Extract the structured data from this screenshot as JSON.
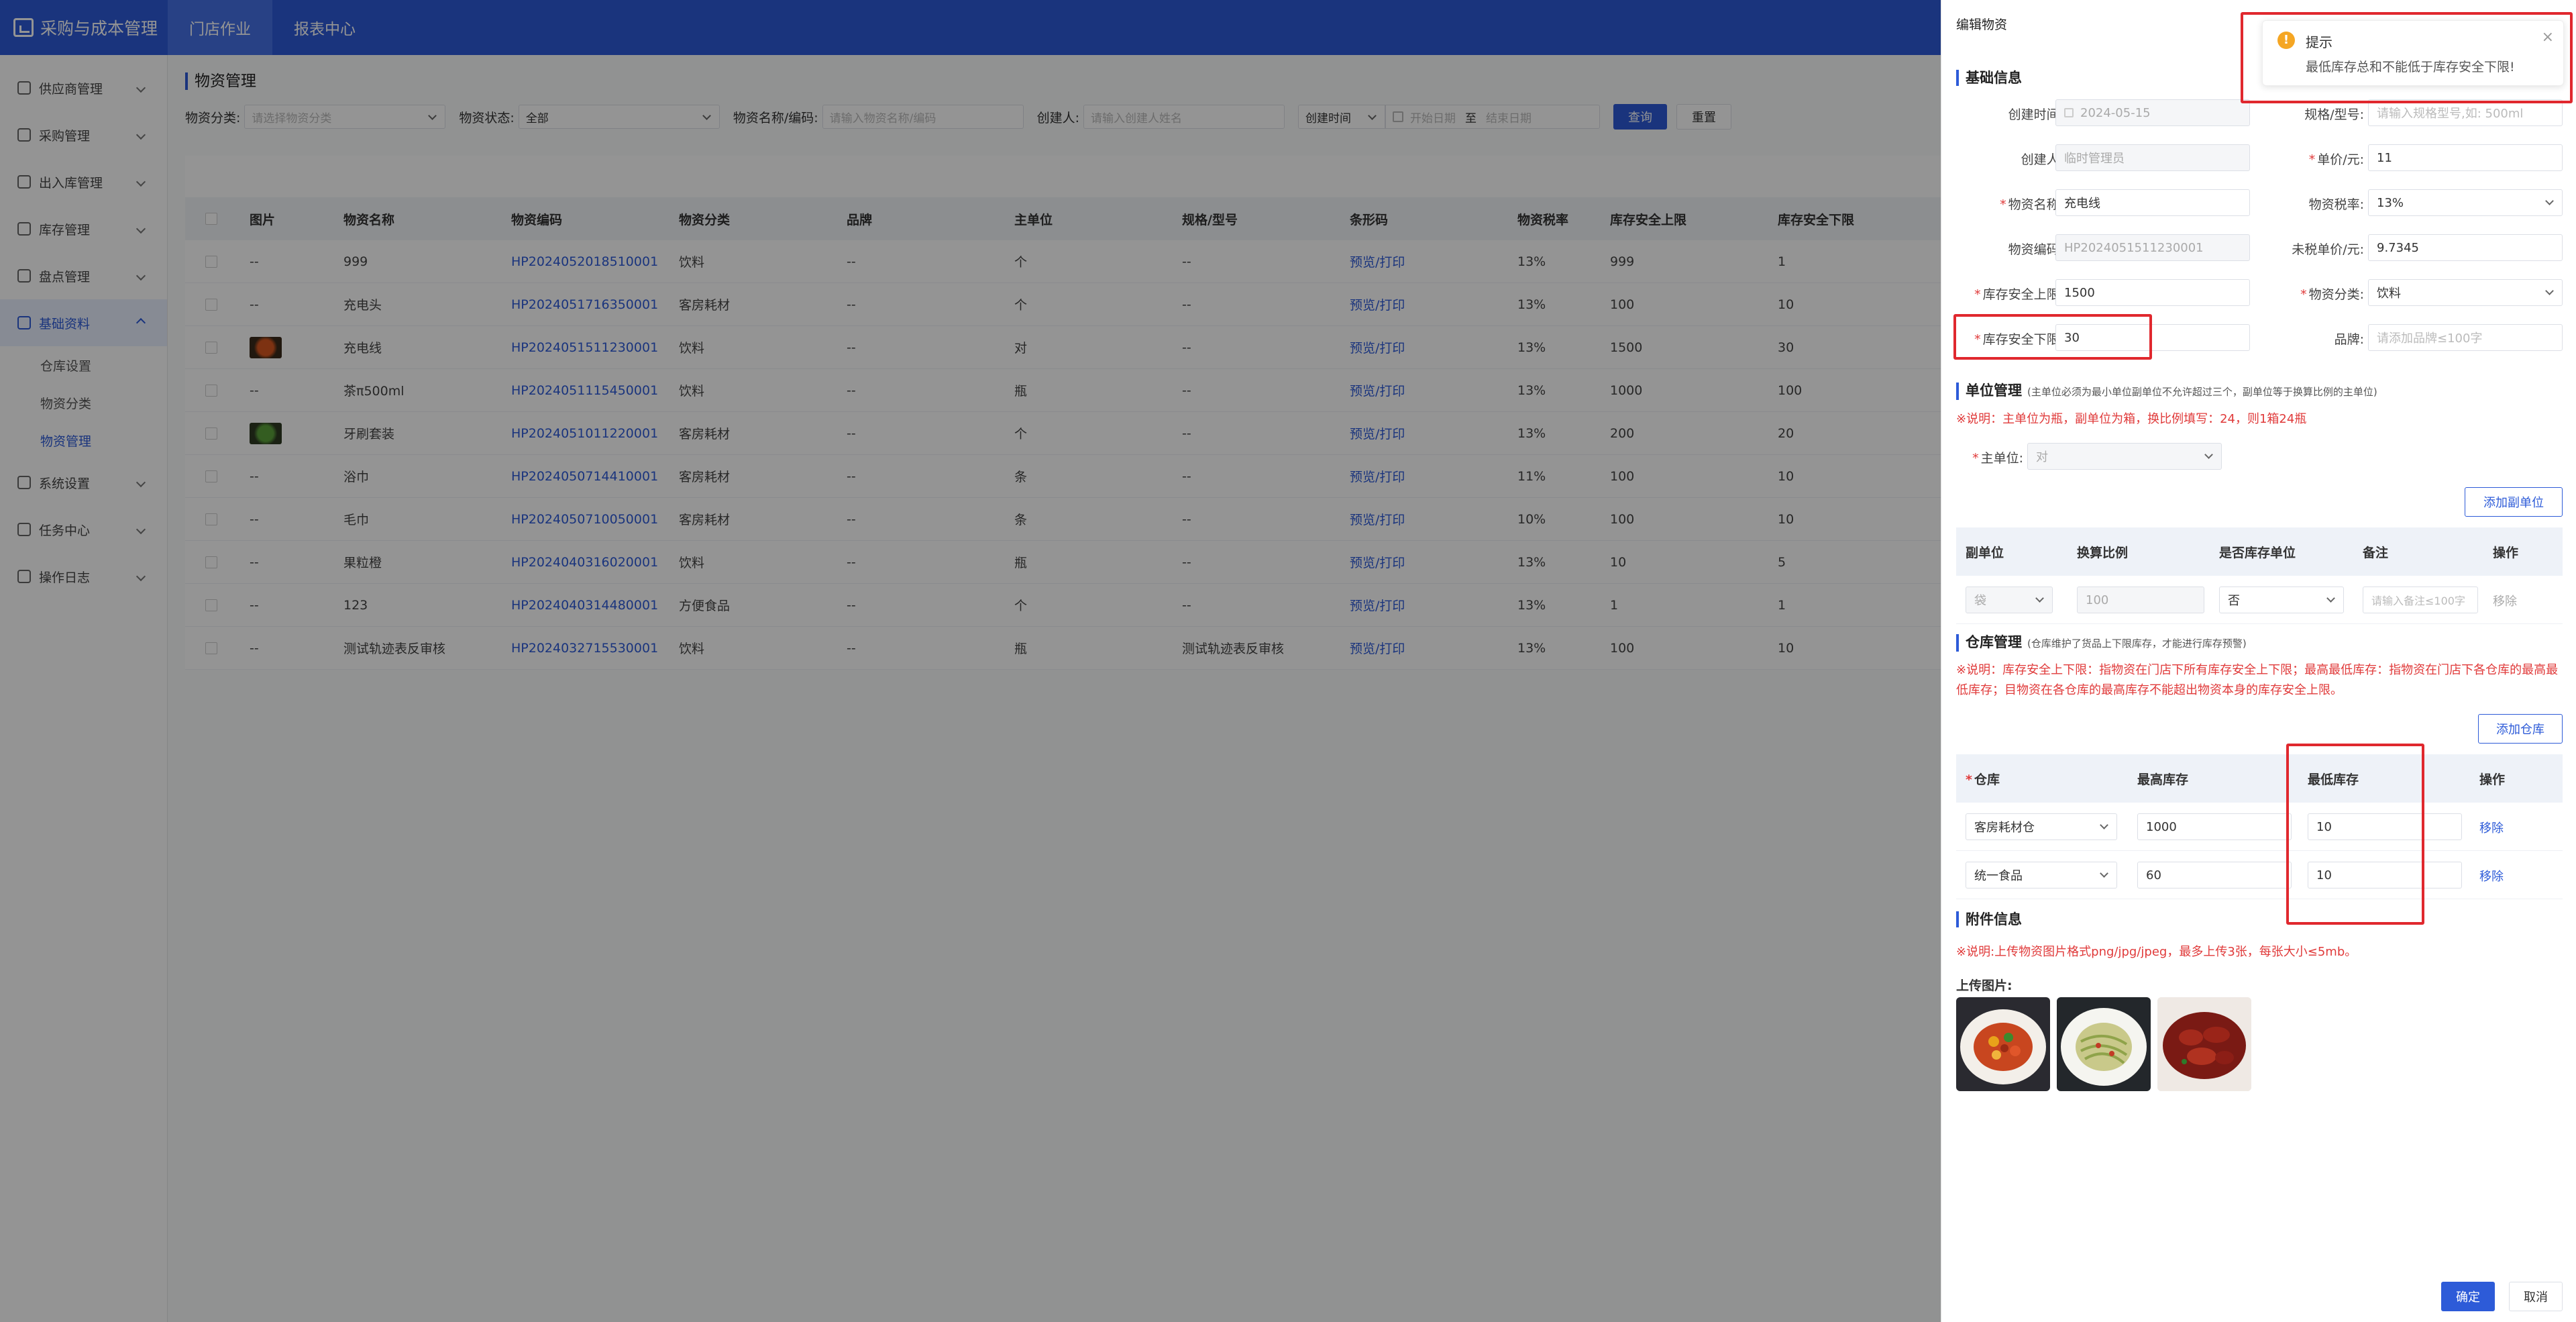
{
  "app": {
    "title": "采购与成本管理"
  },
  "topnav": [
    "门店作业",
    "报表中心"
  ],
  "sidebar": {
    "items": [
      "供应商管理",
      "采购管理",
      "出入库管理",
      "库存管理",
      "盘点管理",
      "基础资料",
      "系统设置",
      "任务中心",
      "操作日志"
    ],
    "sub_items": [
      "仓库设置",
      "物资分类",
      "物资管理"
    ]
  },
  "page": {
    "title": "物资管理"
  },
  "filters": {
    "category_label": "物资分类:",
    "category_placeholder": "请选择物资分类",
    "status_label": "物资状态:",
    "status_value": "全部",
    "name_label": "物资名称/编码:",
    "name_placeholder": "请输入物资名称/编码",
    "creator_label": "创建人:",
    "creator_placeholder": "请输入创建人姓名",
    "time_type": "创建时间",
    "start_placeholder": "开始日期",
    "range_sep": "至",
    "end_placeholder": "结束日期",
    "query_btn": "查询",
    "reset_btn": "重置"
  },
  "table": {
    "columns": [
      "图片",
      "物资名称",
      "物资编码",
      "物资分类",
      "品牌",
      "主单位",
      "规格/型号",
      "条形码",
      "物资税率",
      "库存安全上限",
      "库存安全下限"
    ],
    "rows": [
      {
        "img": "--",
        "name": "999",
        "code": "HP2024052018510001",
        "cat": "饮料",
        "brand": "--",
        "unit": "个",
        "spec": "--",
        "barcode": "预览/打印",
        "tax": "13%",
        "upper": "999",
        "lower": "1"
      },
      {
        "img": "--",
        "name": "充电头",
        "code": "HP2024051716350001",
        "cat": "客房耗材",
        "brand": "--",
        "unit": "个",
        "spec": "--",
        "barcode": "预览/打印",
        "tax": "13%",
        "upper": "100",
        "lower": "10"
      },
      {
        "img": "",
        "name": "充电线",
        "code": "HP2024051511230001",
        "cat": "饮料",
        "brand": "--",
        "unit": "对",
        "spec": "--",
        "barcode": "预览/打印",
        "tax": "13%",
        "upper": "1500",
        "lower": "30"
      },
      {
        "img": "--",
        "name": "茶π500ml",
        "code": "HP2024051115450001",
        "cat": "饮料",
        "brand": "--",
        "unit": "瓶",
        "spec": "--",
        "barcode": "预览/打印",
        "tax": "13%",
        "upper": "1000",
        "lower": "100"
      },
      {
        "img": "",
        "name": "牙刷套装",
        "code": "HP2024051011220001",
        "cat": "客房耗材",
        "brand": "--",
        "unit": "个",
        "spec": "--",
        "barcode": "预览/打印",
        "tax": "13%",
        "upper": "200",
        "lower": "20"
      },
      {
        "img": "--",
        "name": "浴巾",
        "code": "HP2024050714410001",
        "cat": "客房耗材",
        "brand": "--",
        "unit": "条",
        "spec": "--",
        "barcode": "预览/打印",
        "tax": "11%",
        "upper": "100",
        "lower": "10"
      },
      {
        "img": "--",
        "name": "毛巾",
        "code": "HP2024050710050001",
        "cat": "客房耗材",
        "brand": "--",
        "unit": "条",
        "spec": "--",
        "barcode": "预览/打印",
        "tax": "10%",
        "upper": "100",
        "lower": "10"
      },
      {
        "img": "--",
        "name": "果粒橙",
        "code": "HP2024040316020001",
        "cat": "饮料",
        "brand": "--",
        "unit": "瓶",
        "spec": "--",
        "barcode": "预览/打印",
        "tax": "13%",
        "upper": "10",
        "lower": "5"
      },
      {
        "img": "--",
        "name": "123",
        "code": "HP2024040314480001",
        "cat": "方便食品",
        "brand": "--",
        "unit": "个",
        "spec": "--",
        "barcode": "预览/打印",
        "tax": "13%",
        "upper": "1",
        "lower": "1"
      },
      {
        "img": "--",
        "name": "测试轨迹表反审核",
        "code": "HP2024032715530001",
        "cat": "饮料",
        "brand": "--",
        "unit": "瓶",
        "spec": "测试轨迹表反审核",
        "barcode": "预览/打印",
        "tax": "13%",
        "upper": "100",
        "lower": "10"
      }
    ]
  },
  "drawer": {
    "title": "编辑物资",
    "basic": {
      "section": "基础信息",
      "created_time_label": "创建时间:",
      "created_time": "2024-05-15",
      "spec_label": "规格/型号:",
      "spec_placeholder": "请输入规格型号,如: 500ml",
      "creator_label": "创建人:",
      "creator": "临时管理员",
      "price_label": "单价/元:",
      "price": "11",
      "name_label": "物资名称:",
      "name": "充电线",
      "tax_label": "物资税率:",
      "tax": "13%",
      "code_label": "物资编码:",
      "code": "HP2024051511230001",
      "net_price_label": "未税单价/元:",
      "net_price": "9.7345",
      "upper_label": "库存安全上限:",
      "upper": "1500",
      "category_label": "物资分类:",
      "category": "饮料",
      "lower_label": "库存安全下限:",
      "lower": "30",
      "brand_label": "品牌:",
      "brand_placeholder": "请添加品牌≤100字"
    },
    "unit": {
      "section": "单位管理",
      "hint": "(主单位必须为最小单位副单位不允许超过三个，副单位等于换算比例的主单位)",
      "note": "※说明：主单位为瓶，副单位为箱，换比例填写：24，则1箱24瓶",
      "main_unit_label": "主单位:",
      "main_unit": "对",
      "add_btn": "添加副单位",
      "columns": [
        "副单位",
        "换算比例",
        "是否库存单位",
        "备注",
        "操作"
      ],
      "row": {
        "unit": "袋",
        "ratio": "100",
        "is_stock": "否",
        "remark_placeholder": "请输入备注≤100字",
        "action": "移除"
      }
    },
    "warehouse": {
      "section": "仓库管理",
      "hint": "(仓库维护了货品上下限库存，才能进行库存预警)",
      "note": "※说明：库存安全上下限：指物资在门店下所有库存安全上下限；最高最低库存：指物资在门店下各仓库的最高最低库存；目物资在各仓库的最高库存不能超出物资本身的库存安全上限。",
      "add_btn": "添加仓库",
      "columns": [
        "仓库",
        "最高库存",
        "最低库存",
        "操作"
      ],
      "rows": [
        {
          "name": "客房耗材仓",
          "max": "1000",
          "min": "10",
          "action": "移除"
        },
        {
          "name": "统一食品",
          "max": "60",
          "min": "10",
          "action": "移除"
        }
      ]
    },
    "attachments": {
      "section": "附件信息",
      "note": "※说明:上传物资图片格式png/jpg/jpeg，最多上传3张，每张大小≤5mb。",
      "upload_label": "上传图片:"
    },
    "confirm_btn": "确定",
    "cancel_btn": "取消"
  },
  "toast": {
    "title": "提示",
    "message": "最低库存总和不能低于库存安全下限!"
  },
  "colors": {
    "primary": "#2d5bd8",
    "danger": "#e0282e",
    "warning": "#f5a623"
  }
}
